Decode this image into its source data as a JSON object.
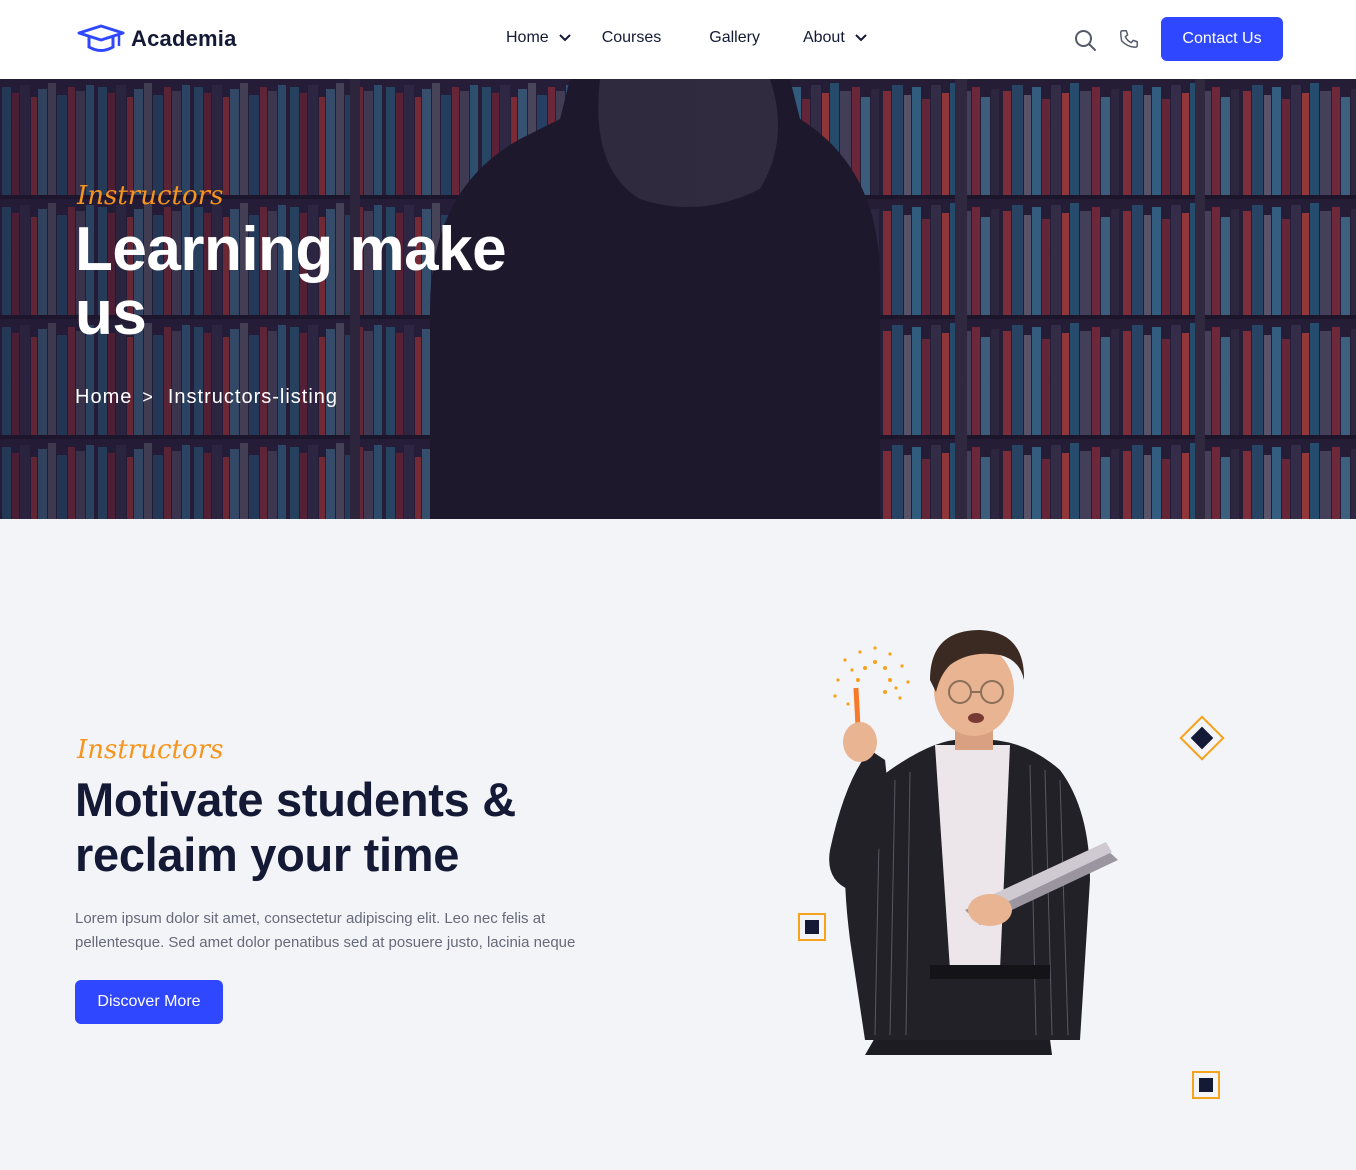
{
  "nav": {
    "brand": "Academia",
    "items": [
      {
        "label": "Home",
        "has_dropdown": true
      },
      {
        "label": "Courses",
        "has_dropdown": false
      },
      {
        "label": "Gallery",
        "has_dropdown": false
      },
      {
        "label": "About",
        "has_dropdown": true
      }
    ],
    "icons": [
      "search-icon",
      "phone-icon"
    ],
    "cta_label": "Contact Us"
  },
  "hero": {
    "tag": "Instructors",
    "title": "Learning make us",
    "breadcrumb": [
      {
        "label": "Home"
      },
      {
        "label": "Instructors-listing"
      }
    ],
    "separator": ">"
  },
  "section": {
    "tag": "Instructors",
    "title": "Motivate students & reclaim your time",
    "description": "Lorem ipsum dolor sit amet, consectetur adipiscing elit. Leo nec felis at pellentesque. Sed amet dolor penatibus sed at posuere justo, lacinia neque",
    "button_label": "Discover More"
  },
  "colors": {
    "primary": "#2f47ff",
    "accent": "#f7941d",
    "heading": "#141a35",
    "body_text": "#666a7a",
    "section_bg": "#f3f4f7"
  }
}
